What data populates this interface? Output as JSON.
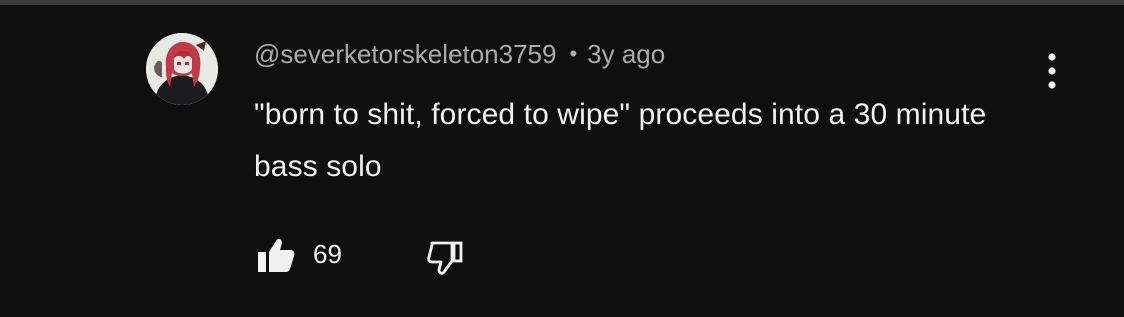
{
  "comment": {
    "author": "@severketorskeleton3759",
    "separator": "•",
    "timestamp": "3y ago",
    "text": "\"born to shit, forced to wipe\" proceeds into a 30 minute bass solo",
    "like_count": "69"
  },
  "icons": {
    "avatar": "avatar-image",
    "menu": "more-vertical-icon",
    "like": "thumbs-up-filled-icon",
    "dislike": "thumbs-down-outline-icon"
  },
  "colors": {
    "background": "#0f0f0f",
    "primary_text": "#f1f1f1",
    "secondary_text": "#aaaaaa",
    "divider": "#3a3a3a"
  }
}
